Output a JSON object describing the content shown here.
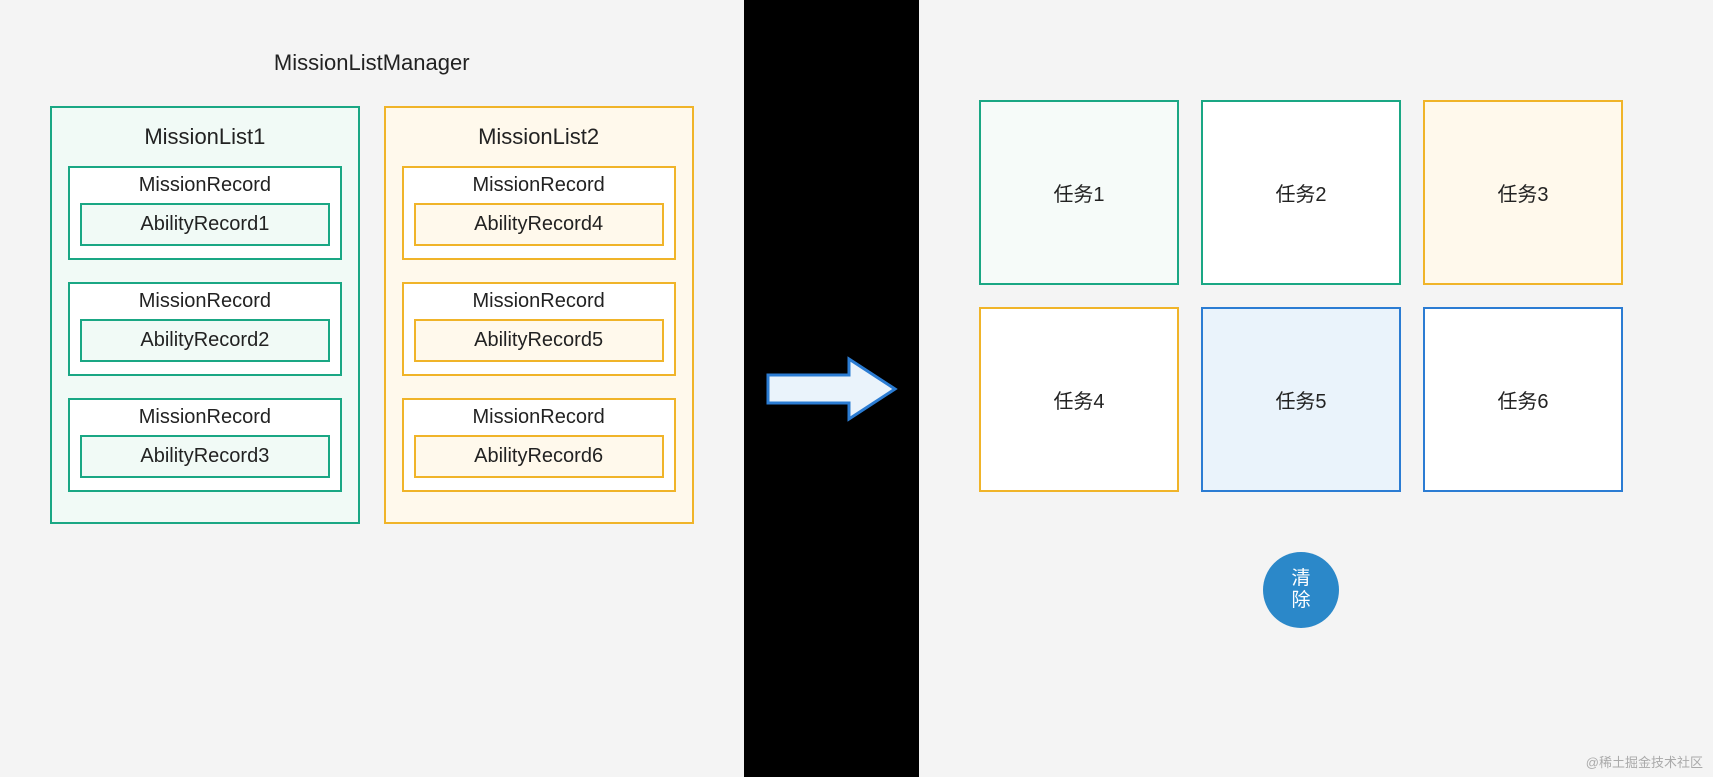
{
  "manager": {
    "title": "MissionListManager"
  },
  "lists": [
    {
      "title": "MissionList1",
      "records": [
        {
          "title": "MissionRecord",
          "ability": "AbilityRecord1"
        },
        {
          "title": "MissionRecord",
          "ability": "AbilityRecord2"
        },
        {
          "title": "MissionRecord",
          "ability": "AbilityRecord3"
        }
      ]
    },
    {
      "title": "MissionList2",
      "records": [
        {
          "title": "MissionRecord",
          "ability": "AbilityRecord4"
        },
        {
          "title": "MissionRecord",
          "ability": "AbilityRecord5"
        },
        {
          "title": "MissionRecord",
          "ability": "AbilityRecord6"
        }
      ]
    }
  ],
  "tasks": [
    {
      "label": "任务1",
      "style": "task-green"
    },
    {
      "label": "任务2",
      "style": "task-green-fill"
    },
    {
      "label": "任务3",
      "style": "task-yellow"
    },
    {
      "label": "任务4",
      "style": "task-yellow-plain"
    },
    {
      "label": "任务5",
      "style": "task-blue"
    },
    {
      "label": "任务6",
      "style": "task-blue-plain"
    }
  ],
  "clear_button": {
    "label": "清\n除"
  },
  "watermark": "@稀土掘金技术社区",
  "colors": {
    "green": "#1aa784",
    "yellow": "#f0b429",
    "blue": "#2b7cd3",
    "arrow_fill": "#eaf3fb",
    "button": "#2b88c9"
  }
}
